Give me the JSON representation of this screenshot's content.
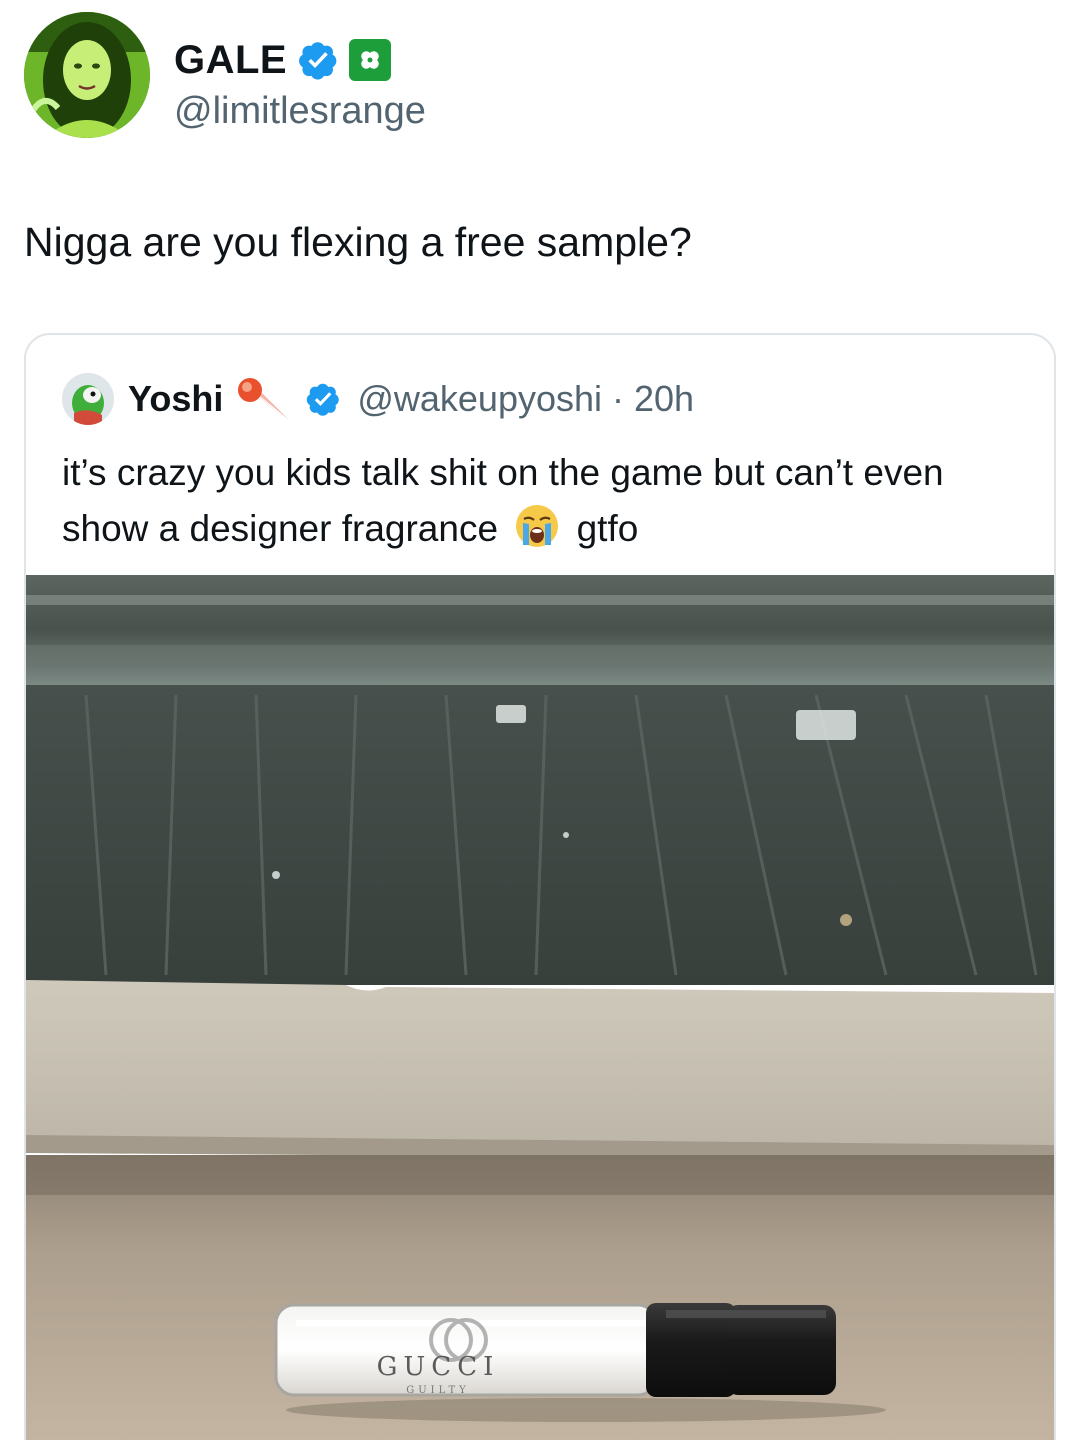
{
  "tweet": {
    "author": {
      "display_name": "GALE",
      "handle": "@limitlesrange",
      "badges": [
        "verified-badge-icon",
        "four-leaf-clover-icon"
      ]
    },
    "text": "Nigga are you flexing a free sample?"
  },
  "quoted_tweet": {
    "author": {
      "display_name": "Yoshi",
      "emoji": "comet-fire-emoji-icon",
      "handle": "@wakeupyoshi",
      "separator": "·",
      "time": "20h"
    },
    "text_part1": "it’s crazy you kids talk shit on the game but can’t even show a designer fragrance",
    "emoji": "loudly-crying-face-emoji-icon",
    "text_part2": "gtfo",
    "image": {
      "description_icon": "fragrance-sample-photo",
      "vial_brand": "GUCCI",
      "vial_subtext": "GUILTY"
    }
  },
  "colors": {
    "verified_blue": "#1d9bf0",
    "handle_gray": "#536471",
    "text": "#0f1419",
    "clover_green": "#1e9e3a"
  }
}
